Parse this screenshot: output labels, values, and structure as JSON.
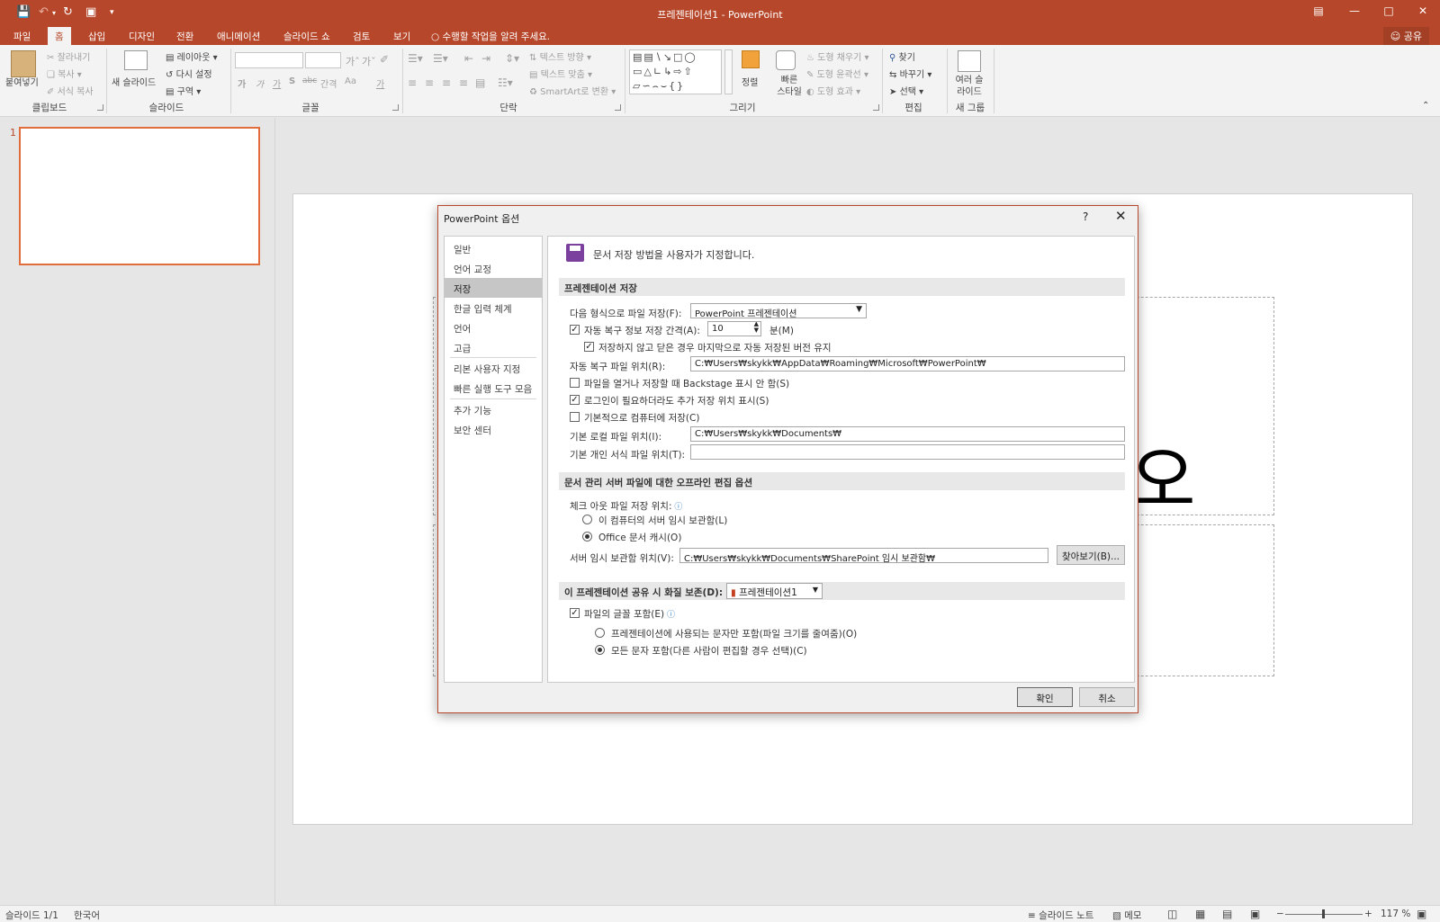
{
  "app": {
    "title": "프레젠테이션1 - PowerPoint",
    "accent": "#b7472a"
  },
  "tabs": [
    "파일",
    "홈",
    "삽입",
    "디자인",
    "전환",
    "애니메이션",
    "슬라이드 쇼",
    "검토",
    "보기"
  ],
  "tell_me": "수행할 작업을 알려 주세요.",
  "share": "공유",
  "ribbon": {
    "clipboard": {
      "paste": "붙여넣기",
      "cut": "잘라내기",
      "copy": "복사",
      "format_painter": "서식 복사",
      "label": "클립보드"
    },
    "slides": {
      "new_slide": "새 슬라이드",
      "layout": "레이아웃",
      "reset": "다시 설정",
      "section": "구역",
      "label": "슬라이드"
    },
    "font": {
      "label": "글꼴",
      "buttons": [
        "가",
        "가",
        "가",
        "S",
        "abc",
        "간격",
        "Aa",
        "가"
      ]
    },
    "paragraph": {
      "text_direction": "텍스트 방향",
      "align_text": "텍스트 맞춤",
      "smartart": "SmartArt로 변환",
      "label": "단락"
    },
    "drawing": {
      "arrange": "정렬",
      "quick_styles": "빠른 스타일",
      "shape_fill": "도형 채우기",
      "shape_outline": "도형 윤곽선",
      "shape_effects": "도형 효과",
      "label": "그리기"
    },
    "editing": {
      "find": "찾기",
      "replace": "바꾸기",
      "select": "선택",
      "label": "편집"
    },
    "new_group": {
      "multi_slide": "여러 슬라이드",
      "label": "새 그룹"
    }
  },
  "slides_pane": {
    "slide_number": "1"
  },
  "slide_text": "오",
  "dialog": {
    "title": "PowerPoint 옵션",
    "help": "?",
    "nav": [
      "일반",
      "언어 교정",
      "저장",
      "한글 입력 체계",
      "언어",
      "고급",
      "리본 사용자 지정",
      "빠른 실행 도구 모음",
      "추가 기능",
      "보안 센터"
    ],
    "selected_nav": "저장",
    "header": "문서 저장 방법을 사용자가 지정합니다.",
    "section1": "프레젠테이션 저장",
    "save_format_label": "다음 형식으로 파일 저장(F):",
    "save_format_value": "PowerPoint 프레젠테이션",
    "autorecover_label": "자동 복구 정보 저장 간격(A):",
    "autorecover_value": "10",
    "minutes_label": "분(M)",
    "keep_last_label": "저장하지 않고 닫은 경우 마지막으로 자동 저장된 버전 유지",
    "autorecover_loc_label": "자동 복구 파일 위치(R):",
    "autorecover_loc_value": "C:₩Users₩skykk₩AppData₩Roaming₩Microsoft₩PowerPoint₩",
    "no_backstage_label": "파일을 열거나 저장할 때 Backstage 표시 안 함(S)",
    "show_additional_label": "로그인이 필요하더라도 추가 저장 위치 표시(S)",
    "save_to_computer_label": "기본적으로 컴퓨터에 저장(C)",
    "default_local_label": "기본 로컬 파일 위치(I):",
    "default_local_value": "C:₩Users₩skykk₩Documents₩",
    "personal_templates_label": "기본 개인 서식 파일 위치(T):",
    "personal_templates_value": "",
    "section2": "문서 관리 서버 파일에 대한 오프라인 편집 옵션",
    "checkout_label": "체크 아웃 파일 저장 위치:",
    "server_drafts_radio": "이 컴퓨터의 서버 임시 보관함(L)",
    "office_cache_radio": "Office 문서 캐시(O)",
    "server_drafts_loc_label": "서버 임시 보관함 위치(V):",
    "server_drafts_loc_value": "C:₩Users₩skykk₩Documents₩SharePoint 임시 보관함₩",
    "browse": "찾아보기(B)...",
    "section3": "이 프레젠테이션 공유 시 화질 보존(D):",
    "section3_file": "프레젠테이션1",
    "embed_fonts_label": "파일의 글꼴 포함(E)",
    "embed_used_label": "프레젠테이션에 사용되는 문자만 포함(파일 크기를 줄여줌)(O)",
    "embed_all_label": "모든 문자 포함(다른 사람이 편집할 경우 선택)(C)",
    "ok": "확인",
    "cancel": "취소"
  },
  "status": {
    "slide": "슬라이드 1/1",
    "language": "한국어",
    "notes": "슬라이드 노트",
    "comments": "메모",
    "zoom": "117 %"
  }
}
